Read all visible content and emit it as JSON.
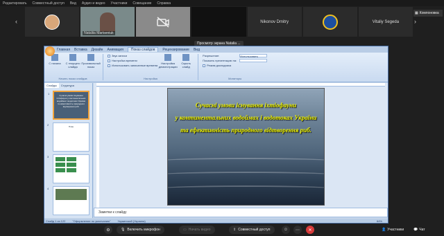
{
  "top_menu": [
    "Редактировать",
    "Совместный доступ",
    "Вид",
    "Аудио и видео",
    "Участники",
    "Совещание",
    "Справка"
  ],
  "tiles": [
    {
      "type": "avatar",
      "name": ""
    },
    {
      "type": "video",
      "name": "Nataliia Martseniuk"
    },
    {
      "type": "camera-off",
      "name": ""
    },
    {
      "type": "blank",
      "name": ""
    },
    {
      "type": "label",
      "name": "Nikonov Dmitry"
    },
    {
      "type": "emblem",
      "name": ""
    },
    {
      "type": "label",
      "name": "Vitaliy Segeda"
    }
  ],
  "layout_button": "Компоновка",
  "share_label": "Просмотр экрана Natalia ...",
  "ppt": {
    "tabs": [
      "Главная",
      "Вставка",
      "Дизайн",
      "Анимация",
      "Показ слайдов",
      "Рецензирование",
      "Вид"
    ],
    "active_tab": "Показ слайдов",
    "groups": [
      {
        "name": "Начать показ слайдов",
        "buttons": [
          "С начала",
          "С текущего слайда",
          "Произвольный показ",
          ""
        ]
      },
      {
        "name": "Настройка",
        "buttons": [
          "Настройка демонстрации",
          "Скрыть слайд"
        ],
        "options": [
          "Звук записи",
          "Настройка времени",
          "Использовать записанные времена"
        ]
      },
      {
        "name": "Мониторы",
        "options": [
          "Разрешение:",
          "Показать презентацию на:",
          "Режим докладчика"
        ],
        "dropdowns": [
          "Использовать текущее",
          ""
        ]
      }
    ],
    "panel_tabs": [
      "Слайды",
      "Структура"
    ],
    "thumbs": [
      {
        "num": "1",
        "text": "Сучасні умови існування іхтіофауни у континентальних водоймах і водотоках України та ефективність природного відтворення риб."
      },
      {
        "num": "2",
        "text": "План"
      },
      {
        "num": "3",
        "text": ""
      },
      {
        "num": "4",
        "text": ""
      }
    ],
    "slide_title": [
      "Сучасні умови існування іхтіофауни",
      "у континентальних водоймах і водотоках України",
      "та ефективність природного відтворення риб."
    ],
    "notes_placeholder": "Заметки к слайду",
    "status": [
      "Слайд 1 из 122",
      "\"Оформление по умолчанию\"",
      "Украинский (Украина)"
    ],
    "zoom": "64%"
  },
  "bottom": {
    "mic": "Включить микрофон",
    "video": "Начать видео",
    "share": "Совместный доступ",
    "participants": "Участники",
    "chat": "Чат"
  }
}
